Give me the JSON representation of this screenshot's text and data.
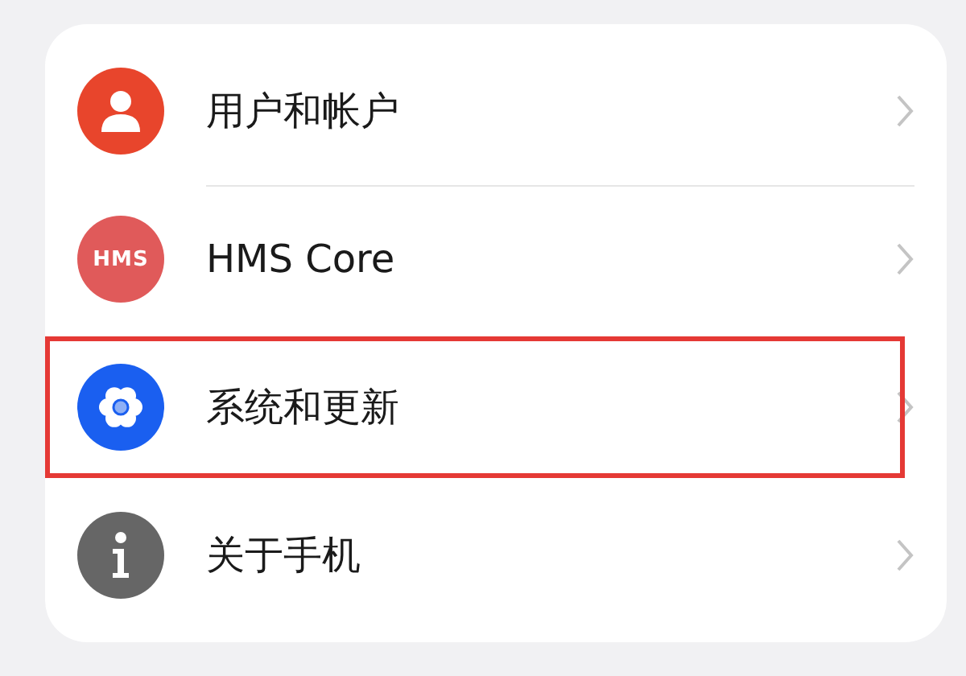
{
  "settings_list": [
    {
      "kind": "person",
      "label": "用户和帐户",
      "highlighted": false,
      "color": "#e8452c"
    },
    {
      "kind": "badge",
      "icon_text": "HMS",
      "label": "HMS Core",
      "highlighted": false,
      "color": "#e05a5a"
    },
    {
      "kind": "gear",
      "label": "系统和更新",
      "highlighted": true,
      "color": "#1a5ff0"
    },
    {
      "kind": "info",
      "label": "关于手机",
      "highlighted": false,
      "color": "#666666"
    }
  ]
}
